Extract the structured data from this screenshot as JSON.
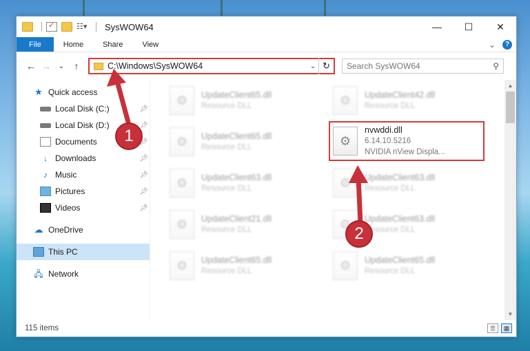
{
  "window": {
    "title": "SysWOW64",
    "min_symbol": "—",
    "max_symbol": "☐",
    "close_symbol": "✕"
  },
  "ribbon": {
    "tabs": [
      "File",
      "Home",
      "Share",
      "View"
    ],
    "chevron": "⌄",
    "help": "?"
  },
  "nav": {
    "back": "←",
    "forward": "→",
    "recent": "⌄",
    "up": "↑",
    "address": "C:\\Windows\\SysWOW64",
    "address_dropdown": "⌄",
    "refresh": "↻",
    "search_placeholder": "Search SysWOW64",
    "search_icon": "⚲"
  },
  "sidebar": {
    "quick_access": "Quick access",
    "items": [
      {
        "label": "Local Disk (C:)",
        "pinned": true
      },
      {
        "label": "Local Disk (D:)",
        "pinned": true
      },
      {
        "label": "Documents",
        "pinned": true
      },
      {
        "label": "Downloads",
        "pinned": true
      },
      {
        "label": "Music",
        "pinned": true
      },
      {
        "label": "Pictures",
        "pinned": true
      },
      {
        "label": "Videos",
        "pinned": true
      }
    ],
    "onedrive": "OneDrive",
    "this_pc": "This PC",
    "network": "Network"
  },
  "files": [
    {
      "name": "UpdateClient65.dll",
      "line2": "Resource DLL",
      "line3": ""
    },
    {
      "name": "UpdateClient42.dll",
      "line2": "Resource DLL",
      "line3": ""
    },
    {
      "name": "UpdateClient65.dll",
      "line2": "Resource DLL",
      "line3": ""
    },
    {
      "name": "nvwddi.dll",
      "line2": "6.14.10.5216",
      "line3": "NVIDIA nView Displa..."
    },
    {
      "name": "UpdateClient63.dll",
      "line2": "Resource DLL",
      "line3": ""
    },
    {
      "name": "UpdateClient63.dll",
      "line2": "Resource DLL",
      "line3": ""
    },
    {
      "name": "UpdateClient21.dll",
      "line2": "Resource DLL",
      "line3": ""
    },
    {
      "name": "UpdateClient63.dll",
      "line2": "Resource DLL",
      "line3": ""
    },
    {
      "name": "UpdateClient65.dll",
      "line2": "Resource DLL",
      "line3": ""
    },
    {
      "name": "UpdateClient65.dll",
      "line2": "Resource DLL",
      "line3": ""
    }
  ],
  "status": {
    "item_count": "115 items"
  },
  "annotations": {
    "step1": "1",
    "step2": "2",
    "color": "#c8303a"
  }
}
